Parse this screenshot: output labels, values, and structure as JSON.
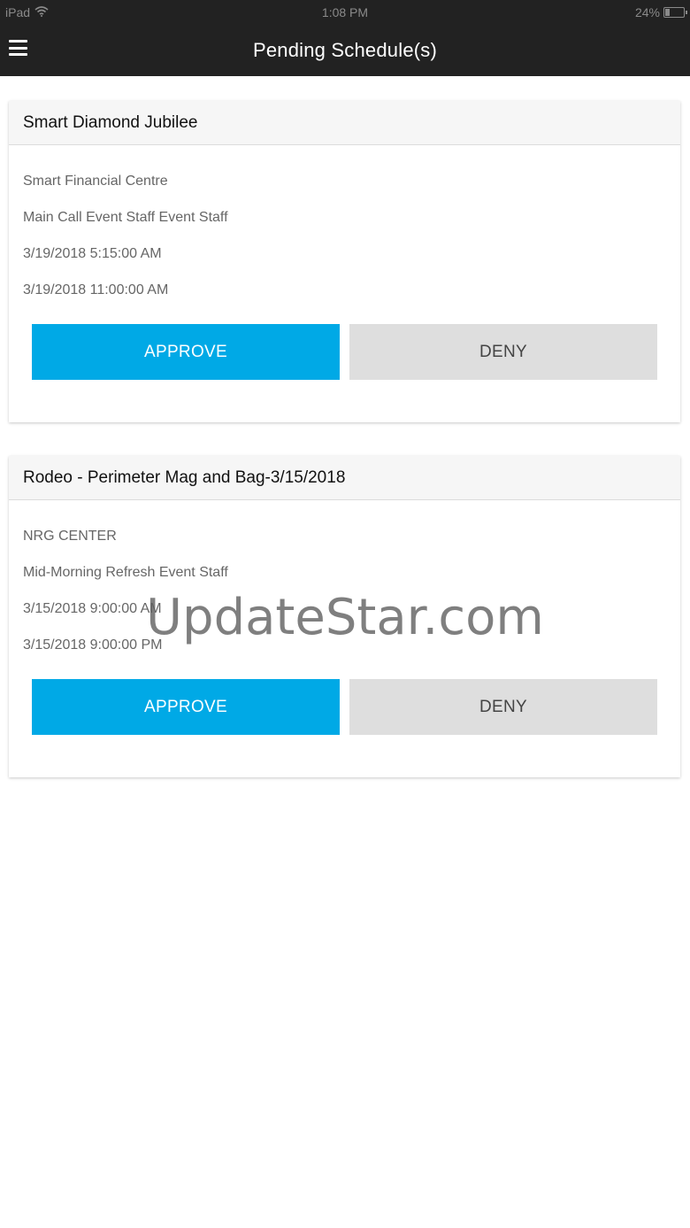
{
  "status_bar": {
    "device": "iPad",
    "time": "1:08 PM",
    "battery_text": "24%",
    "battery_level": 0.24,
    "wifi_icon": "wifi-icon"
  },
  "header": {
    "title": "Pending Schedule(s)",
    "menu_icon": "hamburger-menu-icon",
    "background": "#222222"
  },
  "schedules": [
    {
      "title": "Smart Diamond Jubilee",
      "venue": "Smart Financial Centre",
      "role": "Main Call Event Staff Event Staff",
      "start": "3/19/2018 5:15:00 AM",
      "end": "3/19/2018 11:00:00 AM",
      "approve_label": "APPROVE",
      "deny_label": "DENY"
    },
    {
      "title": "Rodeo - Perimeter Mag and Bag-3/15/2018",
      "venue": "NRG CENTER",
      "role": "Mid-Morning Refresh Event Staff",
      "start": "3/15/2018 9:00:00 AM",
      "end": "3/15/2018 9:00:00 PM",
      "approve_label": "APPROVE",
      "deny_label": "DENY"
    }
  ],
  "colors": {
    "approve": "#00a9e6",
    "deny": "#dedede"
  },
  "watermark": "UpdateStar.com"
}
